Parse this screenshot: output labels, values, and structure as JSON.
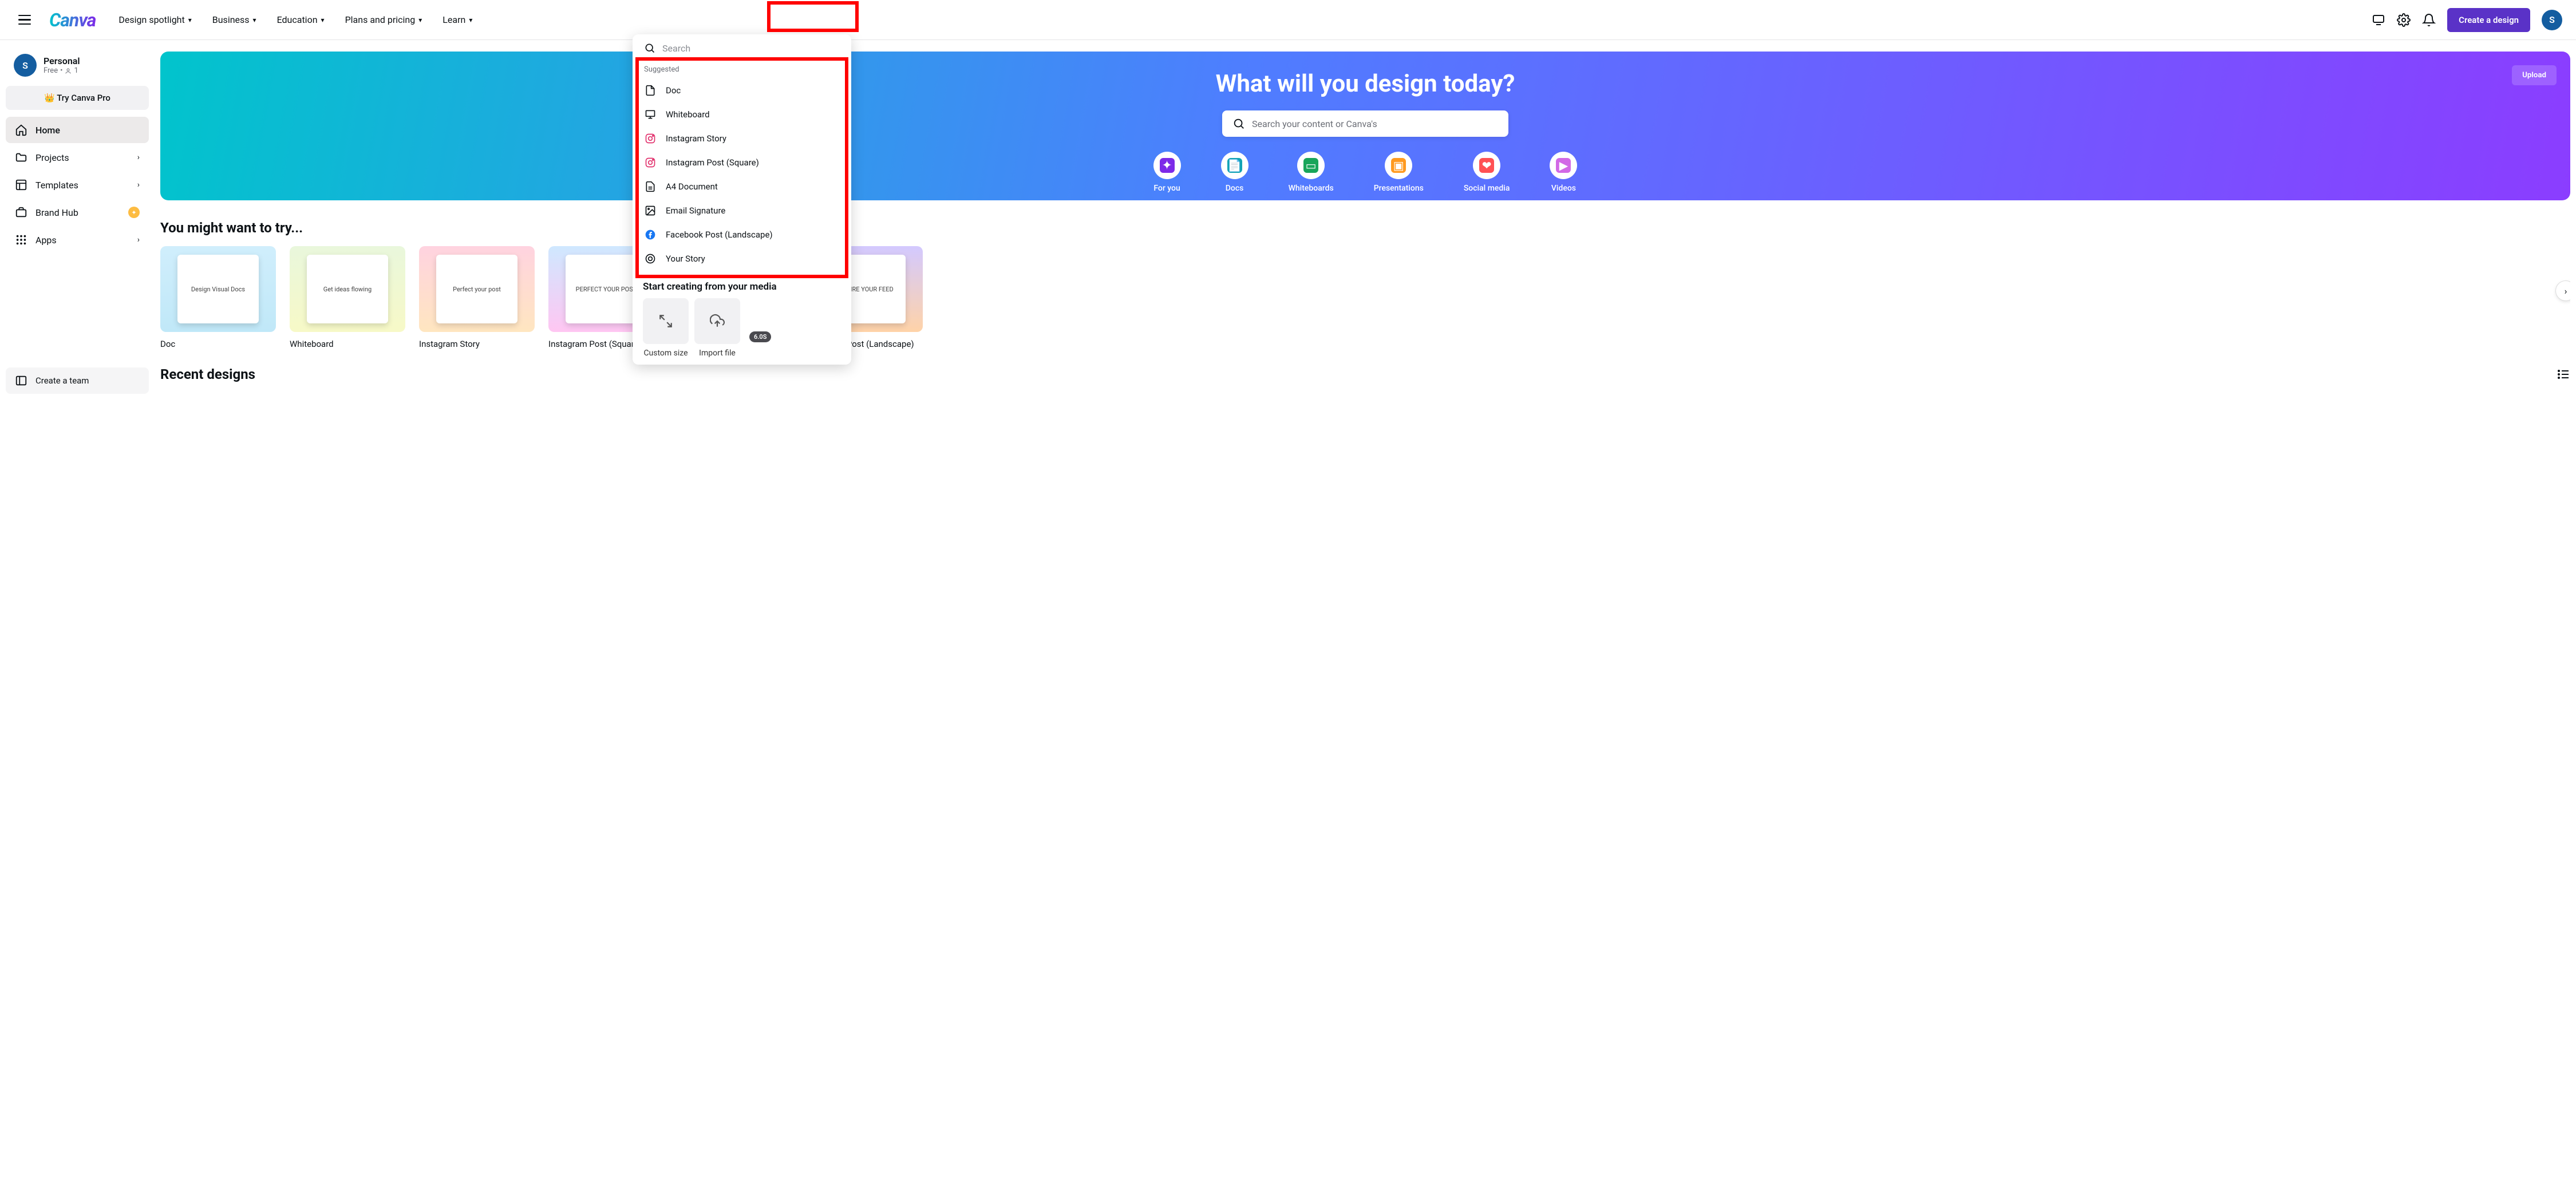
{
  "nav": {
    "logo": "Canva",
    "menu": [
      "Design spotlight",
      "Business",
      "Education",
      "Plans and pricing",
      "Learn"
    ],
    "create_label": "Create a design",
    "avatar_initial": "S"
  },
  "sidebar": {
    "workspace_name": "Personal",
    "workspace_sub_plan": "Free",
    "workspace_sub_sep": "•",
    "workspace_sub_count": "1",
    "try_pro": "Try Canva Pro",
    "items": [
      {
        "label": "Home",
        "has_chevron": false
      },
      {
        "label": "Projects",
        "has_chevron": true
      },
      {
        "label": "Templates",
        "has_chevron": true
      },
      {
        "label": "Brand Hub",
        "has_chevron": false
      },
      {
        "label": "Apps",
        "has_chevron": true
      }
    ],
    "create_team": "Create a team"
  },
  "hero": {
    "title": "What will you design today?",
    "search_placeholder": "Search your content or Canva's",
    "upload_label": "Upload",
    "categories": [
      "For you",
      "Docs",
      "Whiteboards",
      "Presentations",
      "Social media",
      "Videos"
    ]
  },
  "try_section": {
    "heading": "You might want to try...",
    "cards": [
      {
        "title": "Doc",
        "thumb_text": "Design Visual Docs"
      },
      {
        "title": "Whiteboard",
        "thumb_text": "Get ideas flowing"
      },
      {
        "title": "Instagram Story",
        "thumb_text": "Perfect your post"
      },
      {
        "title": "Instagram Post (Square)",
        "thumb_text": "PERFECT YOUR POST"
      },
      {
        "title": "Facebook Post (Landscape)",
        "thumb_text": "INSPIRE YOUR FEED"
      }
    ]
  },
  "recent": {
    "heading": "Recent designs"
  },
  "dropdown": {
    "search_placeholder": "Search",
    "suggested_label": "Suggested",
    "items": [
      {
        "label": "Doc",
        "icon": "doc-icon"
      },
      {
        "label": "Whiteboard",
        "icon": "whiteboard-icon"
      },
      {
        "label": "Instagram Story",
        "icon": "instagram-icon"
      },
      {
        "label": "Instagram Post (Square)",
        "icon": "instagram-icon"
      },
      {
        "label": "A4 Document",
        "icon": "file-icon"
      },
      {
        "label": "Email Signature",
        "icon": "image-icon"
      },
      {
        "label": "Facebook Post (Landscape)",
        "icon": "facebook-icon"
      },
      {
        "label": "Your Story",
        "icon": "story-icon"
      }
    ],
    "media_heading": "Start creating from your media",
    "custom_size": "Custom size",
    "import_file": "Import file",
    "badge": "6.0S"
  }
}
